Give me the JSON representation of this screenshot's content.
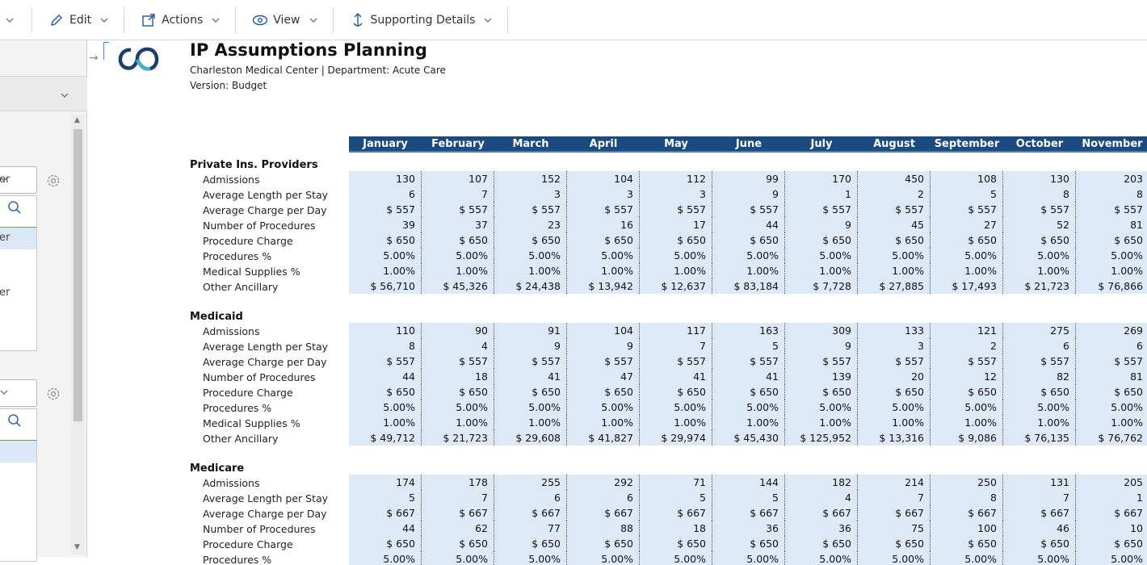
{
  "toolbar": {
    "items": [
      {
        "label": "",
        "icon": "chevron-down-icon"
      },
      {
        "label": "Edit",
        "icon": "pencil-icon"
      },
      {
        "label": "Actions",
        "icon": "external-link-icon"
      },
      {
        "label": "View",
        "icon": "eye-icon"
      },
      {
        "label": "Supporting Details",
        "icon": "anchor-icon"
      }
    ]
  },
  "left_panel": {
    "select1": "er",
    "list1_items": [
      "er",
      "er"
    ],
    "select2": ""
  },
  "report": {
    "title": "IP Assumptions Planning",
    "subtitle": "Charleston Medical Center | Department: Acute Care",
    "version": "Version: Budget"
  },
  "months": [
    "January",
    "February",
    "March",
    "April",
    "May",
    "June",
    "July",
    "August",
    "September",
    "October",
    "November"
  ],
  "sections": [
    {
      "name": "Private Ins. Providers",
      "rows": [
        {
          "label": "Admissions",
          "values": [
            "130",
            "107",
            "152",
            "104",
            "112",
            "99",
            "170",
            "450",
            "108",
            "130",
            "203"
          ]
        },
        {
          "label": "Average Length per Stay",
          "values": [
            "6",
            "7",
            "3",
            "3",
            "3",
            "9",
            "1",
            "2",
            "5",
            "8",
            "8"
          ]
        },
        {
          "label": "Average Charge per Day",
          "values": [
            "$ 557",
            "$ 557",
            "$ 557",
            "$ 557",
            "$ 557",
            "$ 557",
            "$ 557",
            "$ 557",
            "$ 557",
            "$ 557",
            "$ 557"
          ]
        },
        {
          "label": "Number of Procedures",
          "values": [
            "39",
            "37",
            "23",
            "16",
            "17",
            "44",
            "9",
            "45",
            "27",
            "52",
            "81"
          ]
        },
        {
          "label": "Procedure Charge",
          "values": [
            "$ 650",
            "$ 650",
            "$ 650",
            "$ 650",
            "$ 650",
            "$ 650",
            "$ 650",
            "$ 650",
            "$ 650",
            "$ 650",
            "$ 650"
          ]
        },
        {
          "label": "Procedures %",
          "values": [
            "5.00%",
            "5.00%",
            "5.00%",
            "5.00%",
            "5.00%",
            "5.00%",
            "5.00%",
            "5.00%",
            "5.00%",
            "5.00%",
            "5.00%"
          ]
        },
        {
          "label": "Medical Supplies %",
          "values": [
            "1.00%",
            "1.00%",
            "1.00%",
            "1.00%",
            "1.00%",
            "1.00%",
            "1.00%",
            "1.00%",
            "1.00%",
            "1.00%",
            "1.00%"
          ]
        },
        {
          "label": "Other Ancillary",
          "values": [
            "$ 56,710",
            "$ 45,326",
            "$ 24,438",
            "$ 13,942",
            "$ 12,637",
            "$ 83,184",
            "$ 7,728",
            "$ 27,885",
            "$ 17,493",
            "$ 21,723",
            "$ 76,866"
          ]
        }
      ]
    },
    {
      "name": "Medicaid",
      "rows": [
        {
          "label": "Admissions",
          "values": [
            "110",
            "90",
            "91",
            "104",
            "117",
            "163",
            "309",
            "133",
            "121",
            "275",
            "269"
          ]
        },
        {
          "label": "Average Length per Stay",
          "values": [
            "8",
            "4",
            "9",
            "9",
            "7",
            "5",
            "9",
            "3",
            "2",
            "6",
            "6"
          ]
        },
        {
          "label": "Average Charge per Day",
          "values": [
            "$ 557",
            "$ 557",
            "$ 557",
            "$ 557",
            "$ 557",
            "$ 557",
            "$ 557",
            "$ 557",
            "$ 557",
            "$ 557",
            "$ 557"
          ]
        },
        {
          "label": "Number of Procedures",
          "values": [
            "44",
            "18",
            "41",
            "47",
            "41",
            "41",
            "139",
            "20",
            "12",
            "82",
            "81"
          ]
        },
        {
          "label": "Procedure Charge",
          "values": [
            "$ 650",
            "$ 650",
            "$ 650",
            "$ 650",
            "$ 650",
            "$ 650",
            "$ 650",
            "$ 650",
            "$ 650",
            "$ 650",
            "$ 650"
          ]
        },
        {
          "label": "Procedures %",
          "values": [
            "5.00%",
            "5.00%",
            "5.00%",
            "5.00%",
            "5.00%",
            "5.00%",
            "5.00%",
            "5.00%",
            "5.00%",
            "5.00%",
            "5.00%"
          ]
        },
        {
          "label": "Medical Supplies %",
          "values": [
            "1.00%",
            "1.00%",
            "1.00%",
            "1.00%",
            "1.00%",
            "1.00%",
            "1.00%",
            "1.00%",
            "1.00%",
            "1.00%",
            "1.00%"
          ]
        },
        {
          "label": "Other Ancillary",
          "values": [
            "$ 49,712",
            "$ 21,723",
            "$ 29,608",
            "$ 41,827",
            "$ 29,974",
            "$ 45,430",
            "$ 125,952",
            "$ 13,316",
            "$ 9,086",
            "$ 76,135",
            "$ 76,762"
          ]
        }
      ]
    },
    {
      "name": "Medicare",
      "rows": [
        {
          "label": "Admissions",
          "values": [
            "174",
            "178",
            "255",
            "292",
            "71",
            "144",
            "182",
            "214",
            "250",
            "131",
            "205"
          ]
        },
        {
          "label": "Average Length per Stay",
          "values": [
            "5",
            "7",
            "6",
            "6",
            "5",
            "5",
            "4",
            "7",
            "8",
            "7",
            "1"
          ]
        },
        {
          "label": "Average Charge per Day",
          "values": [
            "$ 667",
            "$ 667",
            "$ 667",
            "$ 667",
            "$ 667",
            "$ 667",
            "$ 667",
            "$ 667",
            "$ 667",
            "$ 667",
            "$ 667"
          ]
        },
        {
          "label": "Number of Procedures",
          "values": [
            "44",
            "62",
            "77",
            "88",
            "18",
            "36",
            "36",
            "75",
            "100",
            "46",
            "10"
          ]
        },
        {
          "label": "Procedure Charge",
          "values": [
            "$ 650",
            "$ 650",
            "$ 650",
            "$ 650",
            "$ 650",
            "$ 650",
            "$ 650",
            "$ 650",
            "$ 650",
            "$ 650",
            "$ 650"
          ]
        },
        {
          "label": "Procedures %",
          "values": [
            "5.00%",
            "5.00%",
            "5.00%",
            "5.00%",
            "5.00%",
            "5.00%",
            "5.00%",
            "5.00%",
            "5.00%",
            "5.00%",
            "5.00%"
          ]
        }
      ]
    }
  ],
  "colors": {
    "header_bg": "#1b4a7e",
    "cell_bg": "#dde9f7",
    "accent": "#1f5a9c"
  }
}
